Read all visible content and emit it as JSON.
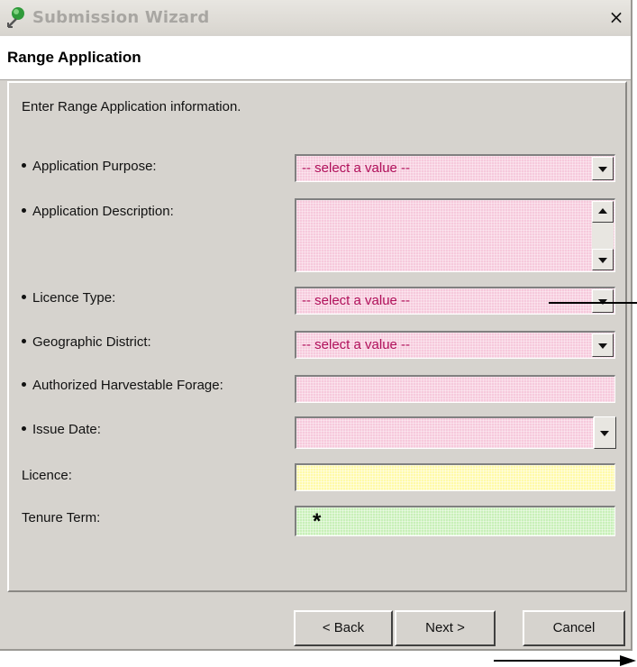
{
  "window": {
    "title": "Submission Wizard",
    "close_label": "×"
  },
  "header": {
    "title": "Range Application"
  },
  "form": {
    "instruction": "Enter Range Application information.",
    "fields": {
      "application_purpose": {
        "label": "Application Purpose:",
        "value": "-- select a value --",
        "required": true
      },
      "application_description": {
        "label": "Application Description:",
        "value": "",
        "required": true
      },
      "licence_type": {
        "label": "Licence Type:",
        "value": "-- select a value --",
        "required": true
      },
      "geographic_district": {
        "label": "Geographic District:",
        "value": "-- select a value --",
        "required": true
      },
      "authorized_harvestable_forage": {
        "label": "Authorized Harvestable Forage:",
        "value": "",
        "required": true
      },
      "issue_date": {
        "label": "Issue Date:",
        "value": "",
        "required": true
      },
      "licence": {
        "label": "Licence:",
        "value": "",
        "required": false
      },
      "tenure_term": {
        "label": "Tenure Term:",
        "value": "",
        "required": false,
        "marker": "*"
      }
    }
  },
  "buttons": {
    "back": "< Back",
    "next": "Next >",
    "cancel": "Cancel"
  },
  "colors": {
    "required_field": "#f6c9dc",
    "derived_field": "#fffaa8",
    "default_field": "#c8f0b8",
    "window_bg": "#d6d3ce"
  },
  "icons": {
    "app": "wizard-app-icon",
    "dropdown": "chevron-down-icon",
    "scroll_up": "scroll-up-icon",
    "scroll_down": "scroll-down-icon"
  }
}
